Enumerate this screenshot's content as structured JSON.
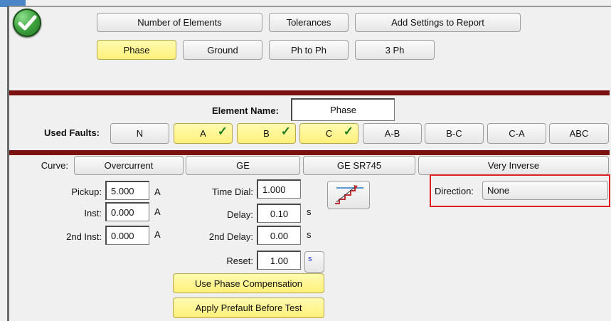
{
  "top_buttons": {
    "number_of_elements": "Number of Elements",
    "tolerances": "Tolerances",
    "add_settings": "Add Settings to Report"
  },
  "element_tabs": [
    {
      "label": "Phase",
      "selected": true
    },
    {
      "label": "Ground",
      "selected": false
    },
    {
      "label": "Ph to Ph",
      "selected": false
    },
    {
      "label": "3 Ph",
      "selected": false
    }
  ],
  "element_name": {
    "label": "Element Name:",
    "value": "Phase"
  },
  "used_faults": {
    "label": "Used Faults:",
    "items": [
      {
        "label": "N",
        "selected": false
      },
      {
        "label": "A",
        "selected": true
      },
      {
        "label": "B",
        "selected": true
      },
      {
        "label": "C",
        "selected": true
      },
      {
        "label": "A-B",
        "selected": false
      },
      {
        "label": "B-C",
        "selected": false
      },
      {
        "label": "C-A",
        "selected": false
      },
      {
        "label": "ABC",
        "selected": false
      }
    ]
  },
  "curve": {
    "label": "Curve:",
    "type": "Overcurrent",
    "manufacturer": "GE",
    "model": "GE SR745",
    "characteristic": "Very Inverse"
  },
  "settings": {
    "pickup": {
      "label": "Pickup:",
      "value": "5.000",
      "unit": "A"
    },
    "inst": {
      "label": "Inst:",
      "value": "0.000",
      "unit": "A"
    },
    "inst2": {
      "label": "2nd Inst:",
      "value": "0.000",
      "unit": "A"
    },
    "time_dial": {
      "label": "Time Dial:",
      "value": "1.000"
    },
    "delay": {
      "label": "Delay:",
      "value": "0.10",
      "unit": "s"
    },
    "delay2": {
      "label": "2nd Delay:",
      "value": "0.00",
      "unit": "s"
    },
    "reset": {
      "label": "Reset:",
      "value": "1.00",
      "unit": "s"
    }
  },
  "direction": {
    "label": "Direction:",
    "value": "None"
  },
  "buttons": {
    "phase_compensation": "Use Phase Compensation",
    "prefault": "Apply Prefault Before Test"
  },
  "colors": {
    "highlight_yellow": "#fff07a",
    "bar_red": "#7a1010",
    "callout_red": "#e02020"
  }
}
